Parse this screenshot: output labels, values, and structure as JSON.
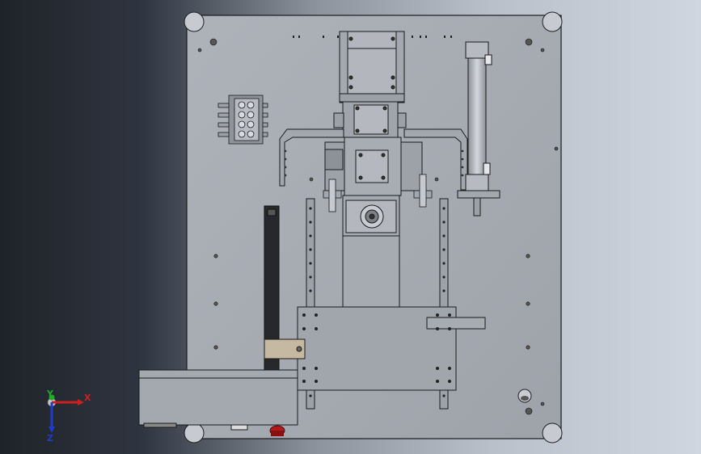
{
  "viewport": {
    "background": [
      "#1f2329",
      "#8d939c",
      "#cfd6df"
    ],
    "plate_color": "#a9adb4",
    "edge_color": "#1b1b1b"
  },
  "triad": {
    "x_label": "X",
    "y_label": "Y",
    "z_label": "Z",
    "x_color": "#cc1f1f",
    "y_color": "#1faa2a",
    "z_color": "#1f3bcc"
  }
}
